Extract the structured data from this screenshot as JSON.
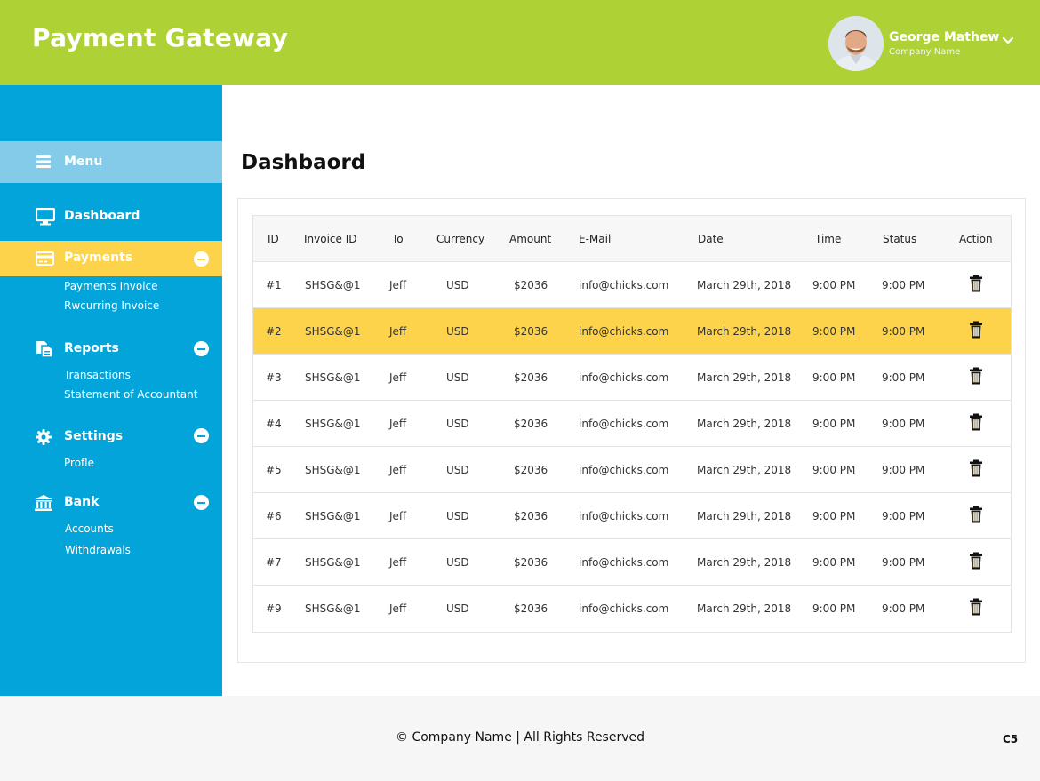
{
  "header": {
    "title": "Payment Gateway",
    "user": {
      "name": "George Mathew",
      "company": "Company Name"
    }
  },
  "sidebar": {
    "menu_label": "Menu",
    "dashboard_label": "Dashboard",
    "groups": [
      {
        "label": "Payments",
        "icon": "credit-card-icon",
        "active": true,
        "links": [
          "Payments Invoice",
          "Rwcurring Invoice"
        ]
      },
      {
        "label": "Reports",
        "icon": "documents-icon",
        "links": [
          "Transactions",
          "Statement of Accountant"
        ]
      },
      {
        "label": "Settings",
        "icon": "gear-icon",
        "links": [
          "Profle"
        ]
      },
      {
        "label": "Bank",
        "icon": "bank-icon",
        "links": [
          "Accounts",
          "Withdrawals"
        ]
      }
    ]
  },
  "main": {
    "title": "Dashbaord",
    "table": {
      "columns": [
        "ID",
        "Invoice ID",
        "To",
        "Currency",
        "Amount",
        "E-Mail",
        "Date",
        "Time",
        "Status",
        "Action"
      ],
      "rows": [
        {
          "id": "#1",
          "invoice": "SHSG&@1",
          "to": "Jeff",
          "currency": "USD",
          "amount": "$2036",
          "email": "info@chicks.com",
          "date": "March 29th, 2018",
          "time": "9:00 PM",
          "status": "9:00 PM"
        },
        {
          "id": "#2",
          "invoice": "SHSG&@1",
          "to": "Jeff",
          "currency": "USD",
          "amount": "$2036",
          "email": "info@chicks.com",
          "date": "March 29th, 2018",
          "time": "9:00 PM",
          "status": "9:00 PM"
        },
        {
          "id": "#3",
          "invoice": "SHSG&@1",
          "to": "Jeff",
          "currency": "USD",
          "amount": "$2036",
          "email": "info@chicks.com",
          "date": "March 29th, 2018",
          "time": "9:00 PM",
          "status": "9:00 PM"
        },
        {
          "id": "#4",
          "invoice": "SHSG&@1",
          "to": "Jeff",
          "currency": "USD",
          "amount": "$2036",
          "email": "info@chicks.com",
          "date": "March 29th, 2018",
          "time": "9:00 PM",
          "status": "9:00 PM"
        },
        {
          "id": "#5",
          "invoice": "SHSG&@1",
          "to": "Jeff",
          "currency": "USD",
          "amount": "$2036",
          "email": "info@chicks.com",
          "date": "March 29th, 2018",
          "time": "9:00 PM",
          "status": "9:00 PM"
        },
        {
          "id": "#6",
          "invoice": "SHSG&@1",
          "to": "Jeff",
          "currency": "USD",
          "amount": "$2036",
          "email": "info@chicks.com",
          "date": "March 29th, 2018",
          "time": "9:00 PM",
          "status": "9:00 PM"
        },
        {
          "id": "#7",
          "invoice": "SHSG&@1",
          "to": "Jeff",
          "currency": "USD",
          "amount": "$2036",
          "email": "info@chicks.com",
          "date": "March 29th, 2018",
          "time": "9:00 PM",
          "status": "9:00 PM"
        },
        {
          "id": "#9",
          "invoice": "SHSG&@1",
          "to": "Jeff",
          "currency": "USD",
          "amount": "$2036",
          "email": "info@chicks.com",
          "date": "March 29th, 2018",
          "time": "9:00 PM",
          "status": "9:00 PM"
        }
      ],
      "highlighted_row": "#2",
      "action_icon": "trash-icon"
    }
  },
  "footer": {
    "copyright": "© Company Name  | All Rights Reserved",
    "code": "C5"
  },
  "colors": {
    "header": "#aed235",
    "sidebar": "#02a4da",
    "menu_bar": "#84cbea",
    "highlight": "#fcd34a"
  }
}
